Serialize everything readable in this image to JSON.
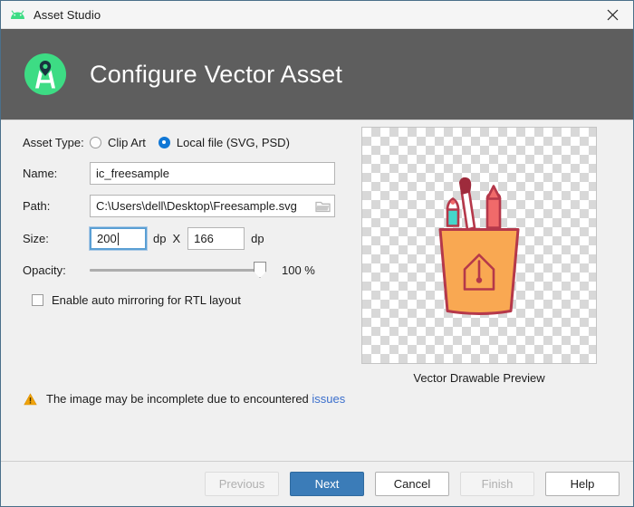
{
  "window": {
    "title": "Asset Studio",
    "app_icon": "android-icon",
    "close_icon": "close-icon"
  },
  "header": {
    "title": "Configure Vector Asset",
    "logo_icon": "android-studio-logo",
    "background_color": "#5e5e5e"
  },
  "form": {
    "asset_type": {
      "label": "Asset Type:",
      "options": [
        {
          "label": "Clip Art",
          "selected": false
        },
        {
          "label": "Local file (SVG, PSD)",
          "selected": true
        }
      ],
      "selected_color": "#1077d5"
    },
    "name": {
      "label": "Name:",
      "value": "ic_freesample",
      "placeholder": ""
    },
    "path": {
      "label": "Path:",
      "value": "C:\\Users\\dell\\Desktop\\Freesample.svg",
      "placeholder": "",
      "browse_icon": "folder-icon"
    },
    "size": {
      "label": "Size:",
      "width_value": "200",
      "height_value": "166",
      "unit": "dp",
      "separator": "X",
      "focused_field": "width"
    },
    "opacity": {
      "label": "Opacity:",
      "value": 100,
      "display": "100 %",
      "min": 0,
      "max": 100
    },
    "mirroring": {
      "label": "Enable auto mirroring for RTL layout",
      "checked": false
    }
  },
  "warning": {
    "icon": "warning-icon",
    "text": "The image may be incomplete due to encountered",
    "link_text": "issues",
    "link_color": "#3b6fcc",
    "icon_color": "#f0a30a"
  },
  "preview": {
    "caption": "Vector Drawable Preview",
    "artwork_name": "pen-holder-cup-illustration",
    "colors": {
      "cup_fill": "#f9a852",
      "cup_outline": "#b5384a",
      "pencil_teal": "#45d7cb",
      "marker_red": "#f06a6a",
      "brush_tip": "#9e2b3c"
    }
  },
  "footer": {
    "buttons": [
      {
        "label": "Previous",
        "style": "disabled"
      },
      {
        "label": "Next",
        "style": "primary"
      },
      {
        "label": "Cancel",
        "style": "normal"
      },
      {
        "label": "Finish",
        "style": "disabled"
      },
      {
        "label": "Help",
        "style": "normal"
      }
    ]
  }
}
